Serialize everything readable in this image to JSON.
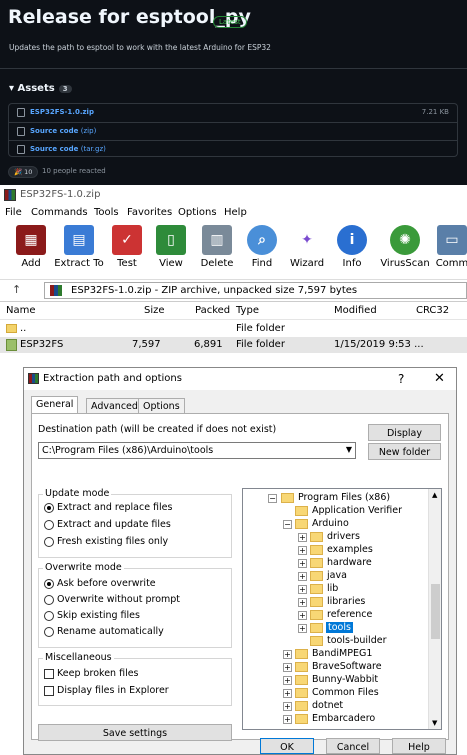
{
  "github": {
    "title": "Release for esptool_py",
    "badge": "Latest",
    "description": "Updates the path to esptool to work with the latest Arduino for ESP32",
    "assets_label": "Assets",
    "assets_count": "3",
    "assets": [
      {
        "name": "ESP32FS-1.0.zip",
        "suffix": "",
        "size": "7.21 KB"
      },
      {
        "name": "Source code",
        "suffix": "(zip)",
        "size": ""
      },
      {
        "name": "Source code",
        "suffix": "(tar.gz)",
        "size": ""
      }
    ],
    "reaction_count": "10",
    "reaction_text": "10 people reacted"
  },
  "winrar": {
    "title": "ESP32FS-1.0.zip",
    "menu": [
      "File",
      "Commands",
      "Tools",
      "Favorites",
      "Options",
      "Help"
    ],
    "toolbar": [
      "Add",
      "Extract To",
      "Test",
      "View",
      "Delete",
      "Find",
      "Wizard",
      "Info",
      "VirusScan",
      "Comm"
    ],
    "address": "ESP32FS-1.0.zip - ZIP archive, unpacked size 7,597 bytes",
    "columns": [
      "Name",
      "Size",
      "Packed",
      "Type",
      "Modified",
      "CRC32"
    ],
    "rows": [
      {
        "name": "..",
        "size": "",
        "packed": "",
        "type": "File folder",
        "modified": ""
      },
      {
        "name": "ESP32FS",
        "size": "7,597",
        "packed": "6,891",
        "type": "File folder",
        "modified": "1/15/2019 9:53 ..."
      }
    ]
  },
  "dialog": {
    "title": "Extraction path and options",
    "help_q": "?",
    "close": "✕",
    "tabs": [
      "General",
      "Advanced",
      "Options"
    ],
    "dest_label": "Destination path (will be created if does not exist)",
    "dest_value": "C:\\Program Files (x86)\\Arduino\\tools",
    "display_btn": "Display",
    "new_folder_btn": "New folder",
    "update_mode": {
      "title": "Update mode",
      "options": [
        "Extract and replace files",
        "Extract and update files",
        "Fresh existing files only"
      ],
      "selected": 0
    },
    "overwrite_mode": {
      "title": "Overwrite mode",
      "options": [
        "Ask before overwrite",
        "Overwrite without prompt",
        "Skip existing files",
        "Rename automatically"
      ],
      "selected": 0
    },
    "misc": {
      "title": "Miscellaneous",
      "options": [
        "Keep broken files",
        "Display files in Explorer"
      ]
    },
    "save_btn": "Save settings",
    "tree": [
      "Program Files (x86)",
      "Application Verifier",
      "Arduino",
      "drivers",
      "examples",
      "hardware",
      "java",
      "lib",
      "libraries",
      "reference",
      "tools",
      "tools-builder",
      "BandiMPEG1",
      "BraveSoftware",
      "Bunny-Wabbit",
      "Common Files",
      "dotnet",
      "Embarcadero"
    ],
    "ok_btn": "OK",
    "cancel_btn": "Cancel",
    "help_btn": "Help"
  }
}
